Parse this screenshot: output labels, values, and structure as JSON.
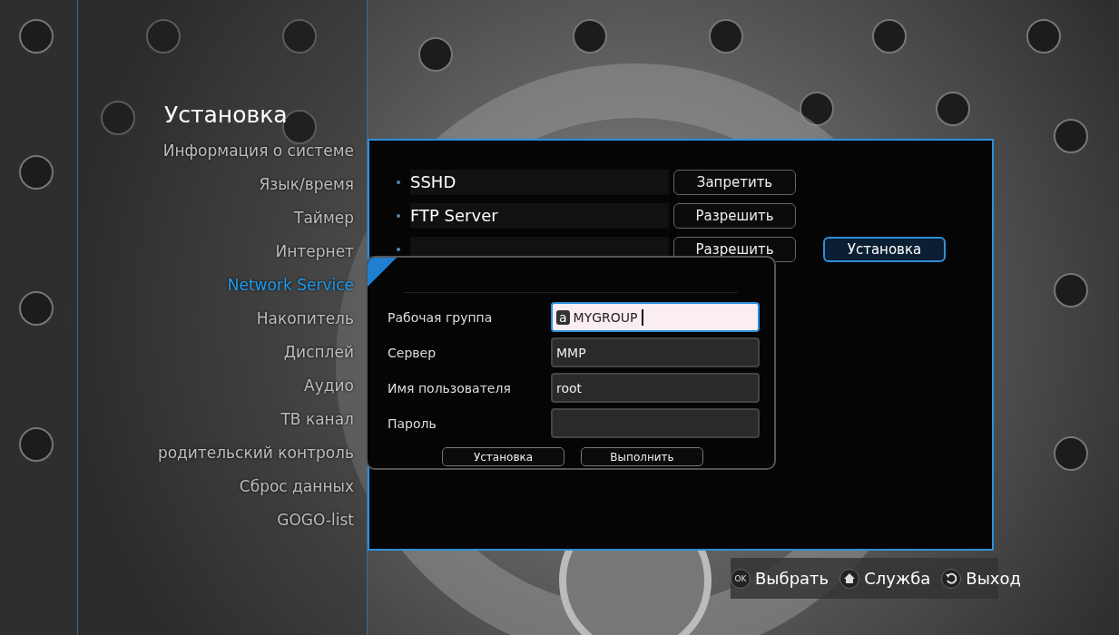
{
  "sidebar": {
    "title": "Установка",
    "items": [
      {
        "label": "Информация о системе",
        "selected": false
      },
      {
        "label": "Язык/время",
        "selected": false
      },
      {
        "label": "Таймер",
        "selected": false
      },
      {
        "label": "Интернет",
        "selected": false
      },
      {
        "label": "Network Service",
        "selected": true
      },
      {
        "label": "Накопитель",
        "selected": false
      },
      {
        "label": "Дисплей",
        "selected": false
      },
      {
        "label": "Аудио",
        "selected": false
      },
      {
        "label": "ТВ канал",
        "selected": false
      },
      {
        "label": "родительский контроль",
        "selected": false
      },
      {
        "label": "Сброс данных",
        "selected": false
      },
      {
        "label": "GOGO-list",
        "selected": false
      }
    ]
  },
  "services": [
    {
      "label": "SSHD",
      "button": "Запретить"
    },
    {
      "label": "FTP Server",
      "button": "Разрешить"
    },
    {
      "button": "Разрешить"
    }
  ],
  "setup_button": "Установка",
  "dialog": {
    "fields": [
      {
        "label": "Рабочая группа",
        "value": "MYGROUP",
        "input_mode": "a",
        "selected": true
      },
      {
        "label": "Сервер",
        "value": "MMP",
        "selected": false
      },
      {
        "label": "Имя пользователя",
        "value": "root",
        "selected": false
      },
      {
        "label": "Пароль",
        "selected": false
      }
    ],
    "buttons": [
      "Установка",
      "Выполнить"
    ]
  },
  "hints": [
    {
      "kind": "ok",
      "key": "OK",
      "label": "Выбрать"
    },
    {
      "kind": "home",
      "label": "Служба"
    },
    {
      "kind": "back",
      "label": "Выход"
    }
  ]
}
